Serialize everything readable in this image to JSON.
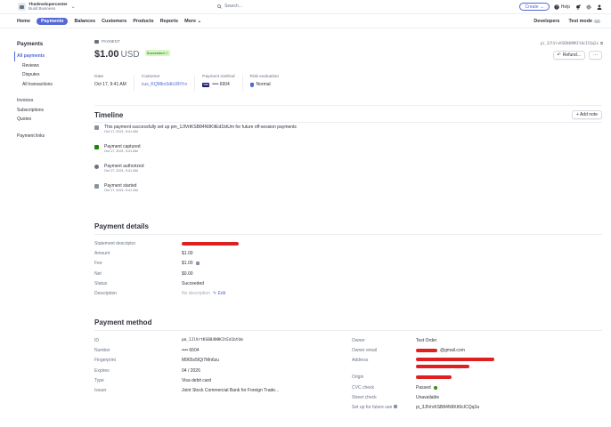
{
  "account": {
    "name": "Thedevelopercenter",
    "subtitle": "Build Business"
  },
  "search": {
    "placeholder": "Search..."
  },
  "topbar": {
    "create_label": "Create",
    "help_label": "Help"
  },
  "nav": {
    "items": [
      "Home",
      "Payments",
      "Balances",
      "Customers",
      "Products",
      "Reports",
      "More"
    ],
    "developers": "Developers",
    "test_mode": "Test mode"
  },
  "sidebar": {
    "title": "Payments",
    "group1": [
      "All payments",
      "Reviews",
      "Disputes",
      "All transactions"
    ],
    "group2": [
      "Invoices",
      "Subscriptions",
      "Quotes"
    ],
    "group3": [
      "Payment links"
    ]
  },
  "header": {
    "breadcrumb": "PAYMENT",
    "amount": "$1.00",
    "currency": "USD",
    "status": "Succeeded ✓",
    "payment_id": "pi_3JlVrvKSB84N9KIt0cICQq2a",
    "refund_label": "Refund...",
    "more_label": "···"
  },
  "meta": {
    "date_label": "Date",
    "date_value": "Oct 17, 9:41 AM",
    "customer_label": "Customer",
    "customer_value": "cus_KQMbvSdb1RtYrv",
    "method_label": "Payment method",
    "method_value": "•••• 6604",
    "risk_label": "Risk evaluation",
    "risk_value": "Normal"
  },
  "timeline": {
    "title": "Timeline",
    "add_note": "+ Add note",
    "events": [
      {
        "text": "This payment successfully set up pm_1JlVrtKSB84N9KItEd1btUm for future off-session payments",
        "time": "Oct 17, 2021, 9:41 AM"
      },
      {
        "text": "Payment captured",
        "time": "Oct 17, 2021, 9:41 AM"
      },
      {
        "text": "Payment authorized",
        "time": "Oct 17, 2021, 9:41 AM"
      },
      {
        "text": "Payment started",
        "time": "Oct 17, 2021, 9:41 AM"
      }
    ]
  },
  "payment_details": {
    "title": "Payment details",
    "rows": [
      {
        "label": "Statement descriptor",
        "value": ""
      },
      {
        "label": "Amount",
        "value": "$1.00"
      },
      {
        "label": "Fee",
        "value": "$1.00"
      },
      {
        "label": "Net",
        "value": "$0.00"
      },
      {
        "label": "Status",
        "value": "Succeeded"
      },
      {
        "label": "Description",
        "value": "No description"
      }
    ],
    "edit_label": "Edit"
  },
  "payment_method": {
    "title": "Payment method",
    "left": [
      {
        "label": "ID",
        "value": "pm_1JlVrtKSB84N9KItEd1btUm"
      },
      {
        "label": "Number",
        "value": "•••• 6604"
      },
      {
        "label": "Fingerprint",
        "value": "M965s5IQi7Mn6zu"
      },
      {
        "label": "Expires",
        "value": "04 / 2026"
      },
      {
        "label": "Type",
        "value": "Visa debit card"
      },
      {
        "label": "Issuer",
        "value": "Joint Stock Commercial Bank for Foreign Trade..."
      }
    ],
    "right": [
      {
        "label": "Owner",
        "value": "Test Order"
      },
      {
        "label": "Owner email",
        "value": "@gmail.com"
      },
      {
        "label": "Address",
        "value": ""
      },
      {
        "label": "Origin",
        "value": ""
      },
      {
        "label": "CVC check",
        "value": "Passed"
      },
      {
        "label": "Street check",
        "value": "Unavailable"
      },
      {
        "label": "Set up for future use",
        "value": "pi_3JlVrvKSB84N9KIt0cICQq2a"
      }
    ]
  }
}
